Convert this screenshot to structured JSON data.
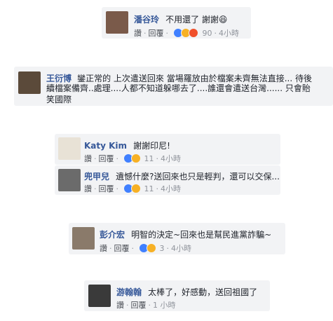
{
  "comments": [
    {
      "author": "潘谷玲",
      "text": "不用還了 謝謝😆",
      "like": "讚",
      "reply": "回覆",
      "count": "90",
      "time": "4小時"
    },
    {
      "author": "王衍博",
      "text_line1": "鑾正常的 上次遣送回來 當場羅放由於檔案未齊無法直接... 待後",
      "text_line2": "續檔案備齊..處理....人都不知道躲哪去了....誰還會遣送台灣...... 只會貽",
      "text_line3": "笑國際"
    },
    {
      "author": "Katy Kim",
      "text": "謝謝印尼!",
      "like": "讚",
      "reply": "回覆",
      "count": "11",
      "time": "4小時"
    },
    {
      "author": "兜甲兒",
      "text": "遺憾什麼?送回來也只是輕判，還可以交保.....",
      "like": "讚",
      "reply": "回覆",
      "count": "11",
      "time": "4小時"
    },
    {
      "author": "彭介宏",
      "text": "明智的決定~回來也是幫民進黨詐騙~",
      "like": "讚",
      "reply": "回覆",
      "count": "3",
      "time": "4小時"
    },
    {
      "author": "游翰翰",
      "text": "太棒了，好感動，送回祖國了",
      "like": "讚",
      "reply": "回覆",
      "time": "1 小時"
    }
  ],
  "colors": {
    "name": "#365899",
    "card_bg": "#f2f3f5",
    "meta": "#90949c",
    "like_blue": "#4080ff",
    "haha_yellow": "#f7b125",
    "angry_red": "#f0502b"
  }
}
